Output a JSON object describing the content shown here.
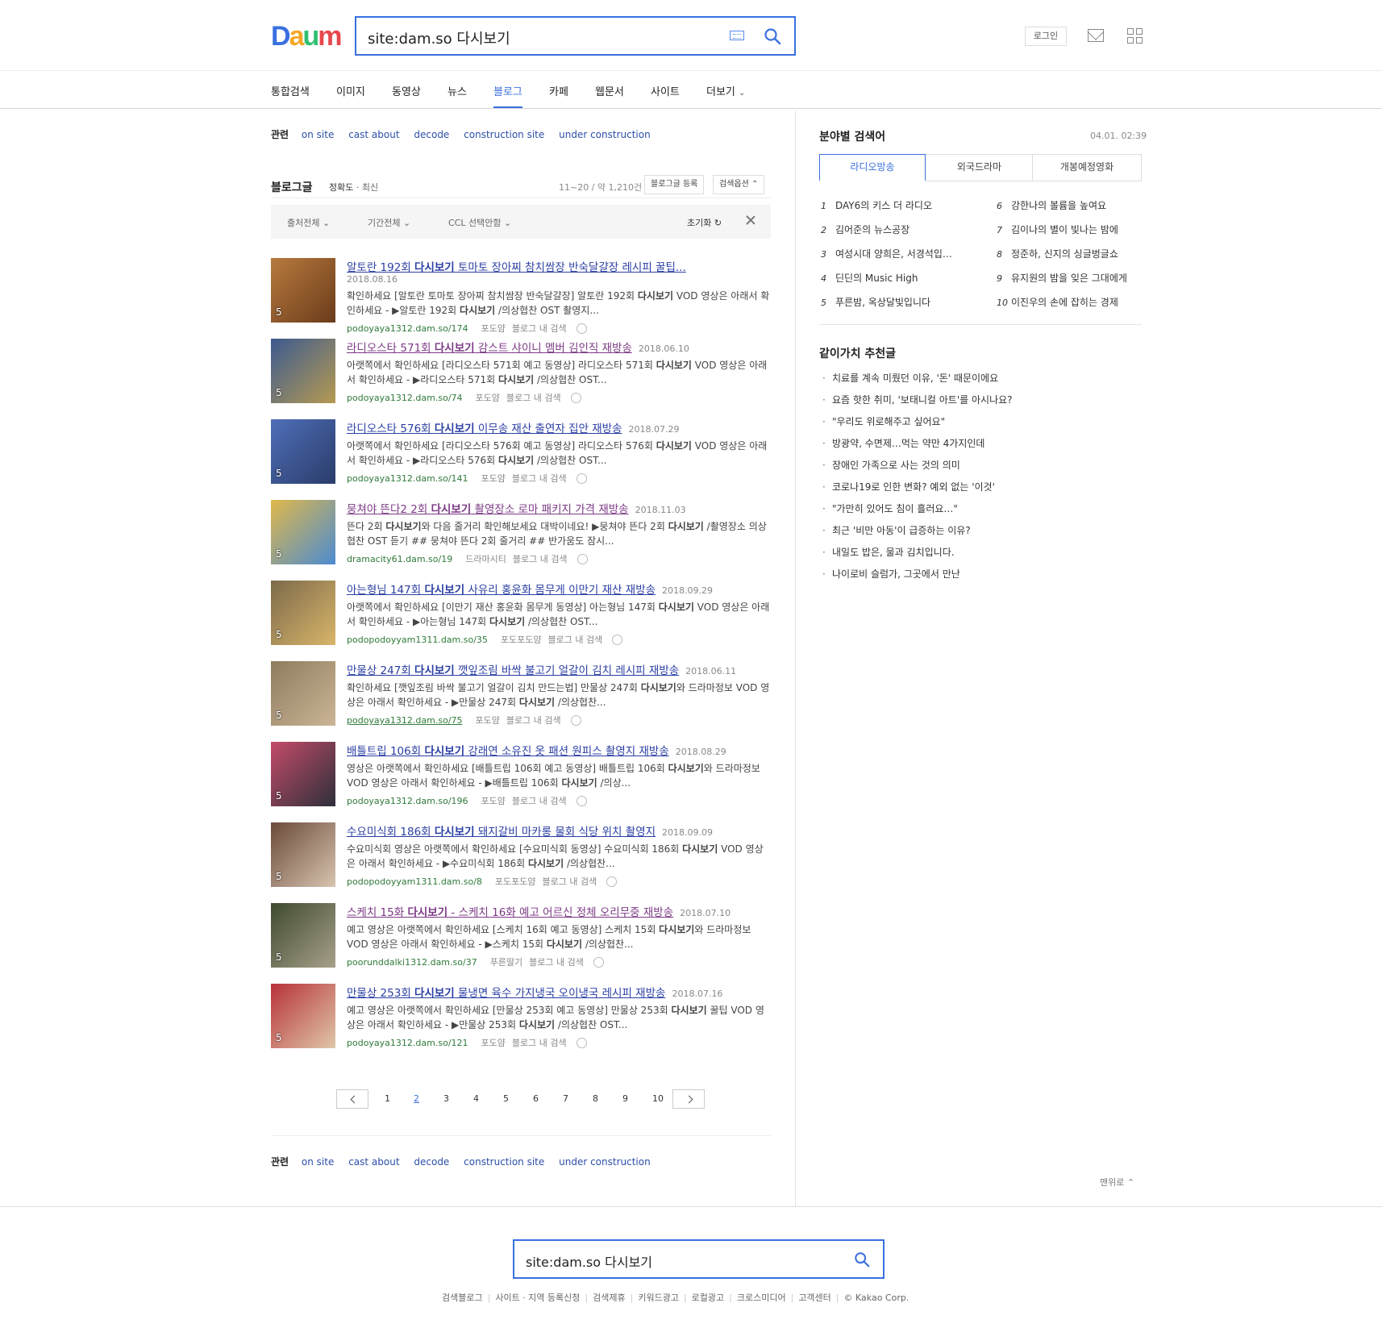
{
  "header": {
    "search_query": "site:dam.so 다시보기",
    "login_label": "로그인"
  },
  "gnb": {
    "items": [
      "통합검색",
      "이미지",
      "동영상",
      "뉴스",
      "블로그",
      "카페",
      "웹문서",
      "사이트",
      "더보기"
    ],
    "active": "블로그"
  },
  "related": {
    "title": "관련",
    "terms": [
      "on site",
      "cast about",
      "decode",
      "construction site",
      "under construction"
    ]
  },
  "blog": {
    "section_title": "블로그글",
    "sort_accuracy": "정확도",
    "sort_recent": "최신",
    "count_text": "11~20 / 약 1,210건",
    "register_label": "블로그글 등록",
    "options_label": "검색옵션"
  },
  "filters": {
    "source": "출처전체",
    "period": "기간전체",
    "ccl": "CCL 선택안함",
    "reset": "초기화"
  },
  "results": [
    {
      "title": "알토란 192회 다시보기 토마토 장아찌 참치쌈장 반숙달걀장 레시피 꿀팁...",
      "date": "2018.08.16",
      "date_newline": true,
      "desc": "확인하세요 [알토란 토마토 장아찌 참치쌈장 반숙달걀장] 알토란 192회 다시보기 VOD 영상은 아래서 확인하세요 - ▶알토란 192회 다시보기 /의상협찬 OST 촬영지...",
      "url": "podoyaya1312.dam.so/174",
      "blog": "포도얌",
      "search_in_blog": "블로그 내 검색",
      "img_count": "5",
      "visited": false
    },
    {
      "title": "라디오스타 571회 다시보기 감스트 샤이니 멤버 김인직 재방송",
      "date": "2018.06.10",
      "date_newline": false,
      "desc": "아랫쪽에서 확인하세요 [라디오스타 571회 예고 동영상] 라디오스타 571회 다시보기 VOD 영상은 아래서 확인하세요 - ▶라디오스타 571회 다시보기 /의상협찬 OST...",
      "url": "podoyaya1312.dam.so/74",
      "blog": "포도얌",
      "search_in_blog": "블로그 내 검색",
      "img_count": "5",
      "visited": true
    },
    {
      "title": "라디오스타 576회 다시보기 이무송 재산 출연자 집안 재방송",
      "date": "2018.07.29",
      "date_newline": false,
      "desc": "아랫쪽에서 확인하세요 [라디오스타 576회 예고 동영상] 라디오스타 576회 다시보기 VOD 영상은 아래서 확인하세요 - ▶라디오스타 576회 다시보기 /의상협찬 OST...",
      "url": "podoyaya1312.dam.so/141",
      "blog": "포도얌",
      "search_in_blog": "블로그 내 검색",
      "img_count": "5",
      "visited": false
    },
    {
      "title": "뭉쳐야 뜬다2 2회 다시보기 촬영장소 로마 패키지 가격 재방송",
      "date": "2018.11.03",
      "date_newline": false,
      "desc": "뜬다 2회 다시보기와 다음 줄거리 확인해보세요 대박이네요! ▶뭉쳐야 뜬다 2회 다시보기 /촬영장소 의상 협찬 OST 듣기 ## 뭉쳐야 뜬다 2회 줄거리 ## 반가움도 잠시...",
      "url": "dramacity61.dam.so/19",
      "blog": "드라마시티",
      "search_in_blog": "블로그 내 검색",
      "img_count": "5",
      "visited": true
    },
    {
      "title": "아는형님 147회 다시보기 사유리 홍윤화 몸무게 이만기 재산 재방송",
      "date": "2018.09.29",
      "date_newline": false,
      "desc": "아랫쪽에서 확인하세요 [이만기 재산 홍윤화 몸무게 동영상] 아는형님 147회 다시보기 VOD 영상은 아래서 확인하세요 - ▶아는형님 147회 다시보기 /의상협찬 OST...",
      "url": "podopodoyyam1311.dam.so/35",
      "blog": "포도포도얌",
      "search_in_blog": "블로그 내 검색",
      "img_count": "5",
      "visited": false
    },
    {
      "title": "만물상 247회 다시보기 깻잎조림 바싹 불고기 얼갈이 김치 레시피 재방송",
      "date": "2018.06.11",
      "date_newline": false,
      "desc": "확인하세요 [깻잎조림 바싹 불고기 얼갈이 김치 만드는법] 만물상 247회 다시보기와 드라마정보 VOD 영상은 아래서 확인하세요 - ▶만물상 247회 다시보기 /의상협찬...",
      "url": "podoyaya1312.dam.so/75",
      "blog": "포도얌",
      "search_in_blog": "블로그 내 검색",
      "img_count": "5",
      "visited": false
    },
    {
      "title": "배틀트립 106회 다시보기 강래연 소유진 옷 패션 원피스 촬영지 재방송",
      "date": "2018.08.29",
      "date_newline": false,
      "desc": "영상은 아랫쪽에서 확인하세요 [배틀트립 106회 예고 동영상] 배틀트립 106회 다시보기와 드라마정보 VOD 영상은 아래서 확인하세요 - ▶배틀트립 106회 다시보기 /의상...",
      "url": "podoyaya1312.dam.so/196",
      "blog": "포도얌",
      "search_in_blog": "블로그 내 검색",
      "img_count": "5",
      "visited": false
    },
    {
      "title": "수요미식회 186회 다시보기 돼지갈비 마카롱 물회 식당 위치 촬영지",
      "date": "2018.09.09",
      "date_newline": false,
      "desc": "수요미식회 영상은 아랫쪽에서 확인하세요 [수요미식회 동영상] 수요미식회 186회 다시보기 VOD 영상은 아래서 확인하세요 - ▶수요미식회 186회 다시보기 /의상협찬...",
      "url": "podopodoyyam1311.dam.so/8",
      "blog": "포도포도얌",
      "search_in_blog": "블로그 내 검색",
      "img_count": "5",
      "visited": false
    },
    {
      "title": "스케치 15화 다시보기 - 스케치 16화 예고 어르신 정체 오리무중 재방송",
      "date": "2018.07.10",
      "date_newline": false,
      "desc": "예고 영상은 아랫쪽에서 확인하세요 [스케치 16회 예고 동영상] 스케치 15회 다시보기와 드라마정보 VOD 영상은 아래서 확인하세요 - ▶스케치 15회 다시보기 /의상협찬...",
      "url": "poorunddalki1312.dam.so/37",
      "blog": "푸른딸기",
      "search_in_blog": "블로그 내 검색",
      "img_count": "5",
      "visited": true
    },
    {
      "title": "만물상 253회 다시보기 물냉면 육수 가지냉국 오이냉국 레시피 재방송",
      "date": "2018.07.16",
      "date_newline": false,
      "desc": "예고 영상은 아랫쪽에서 확인하세요 [만물상 253회 예고 동영상] 만물상 253회 다시보기 꿀팁 VOD 영상은 아래서 확인하세요 - ▶만물상 253회 다시보기 /의상협찬 OST...",
      "url": "podoyaya1312.dam.so/121",
      "blog": "포도얌",
      "search_in_blog": "블로그 내 검색",
      "img_count": "5",
      "visited": false
    }
  ],
  "paging": {
    "pages": [
      "1",
      "2",
      "3",
      "4",
      "5",
      "6",
      "7",
      "8",
      "9",
      "10"
    ],
    "current": "2"
  },
  "ranking": {
    "title": "분야별 검색어",
    "time": "04.01. 02:39",
    "tabs": [
      "라디오방송",
      "외국드라마",
      "개봉예정영화"
    ],
    "active_tab": "라디오방송",
    "left": [
      {
        "n": "1",
        "text": "DAY6의 키스 더 라디오"
      },
      {
        "n": "2",
        "text": "김어준의 뉴스공장"
      },
      {
        "n": "3",
        "text": "여성시대 양희은, 서경석입…"
      },
      {
        "n": "4",
        "text": "딘딘의 Music High"
      },
      {
        "n": "5",
        "text": "푸른밤, 옥상달빛입니다"
      }
    ],
    "right": [
      {
        "n": "6",
        "text": "강한나의 볼륨을 높여요"
      },
      {
        "n": "7",
        "text": "김이나의 별이 빛나는 밤에"
      },
      {
        "n": "8",
        "text": "정준하, 신지의 싱글벙글쇼"
      },
      {
        "n": "9",
        "text": "유지원의 밤을 잊은 그대에게"
      },
      {
        "n": "10",
        "text": "이진우의 손에 잡히는 경제"
      }
    ]
  },
  "recommend": {
    "title": "같이가치 추천글",
    "items": [
      "치료를 계속 미뤘던 이유, '돈' 때문이에요",
      "요즘 핫한 취미, '보태니컬 아트'를 아시나요?",
      "\"우리도 위로해주고 싶어요\"",
      "방광약, 수면제…먹는 약만 4가지인데",
      "장애인 가족으로 사는 것의 의미",
      "코로나19로 인한 변화? 예외 없는 '이것'",
      "\"가만히 있어도 침이 흘러요…\"",
      "최근 '비만 아동'이 급증하는 이유?",
      "내일도 밥은, 물과 김치입니다.",
      "나이로비 슬럼가, 그곳에서 만난"
    ]
  },
  "top_link": "맨위로",
  "footer": {
    "search_query": "site:dam.so 다시보기",
    "links": [
      "검색블로그",
      "사이트 · 지역 등록신청",
      "검색제휴",
      "키워드광고",
      "로컬광고",
      "크로스미디어",
      "고객센터"
    ],
    "copyright": "© Kakao Corp."
  },
  "colors": {
    "accent": "#3a6fe0",
    "link": "#2b3fa3",
    "visited": "#7c3a86",
    "url_green": "#2f7a3a"
  }
}
